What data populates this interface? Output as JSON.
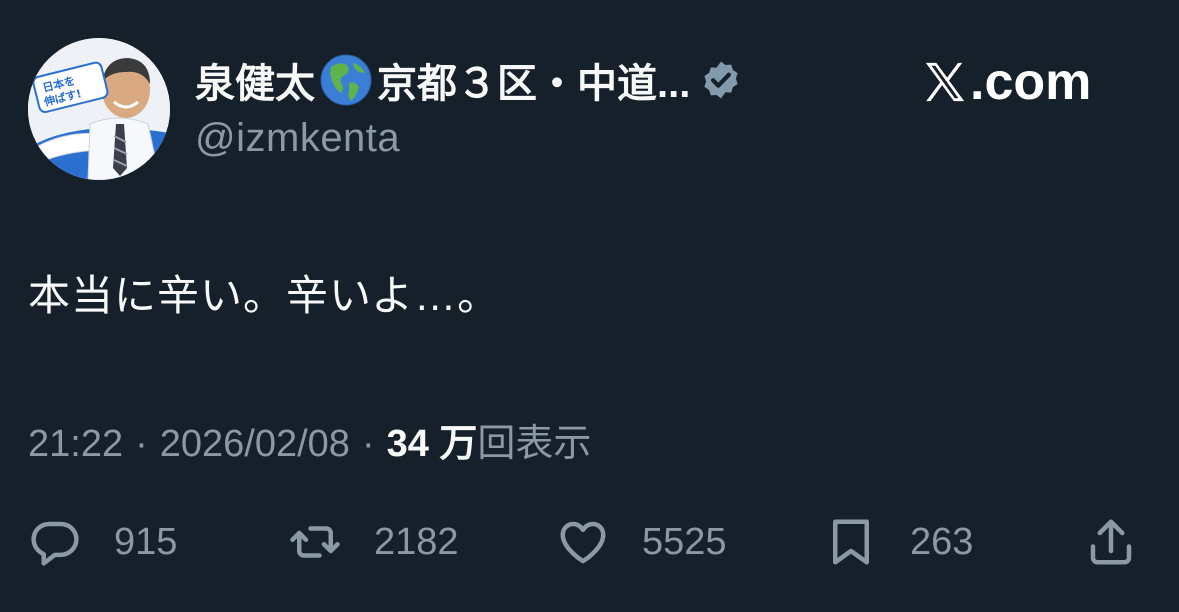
{
  "author": {
    "name_part1": "泉健太",
    "name_part2": "京都３区・中道...",
    "handle": "@izmkenta",
    "avatar_banner_text": "日本を伸ばす!"
  },
  "brand": {
    "label": ".com"
  },
  "tweet": {
    "text": "本当に辛い。辛いよ…。",
    "time": "21:22",
    "date": "2026/02/08",
    "views_count": "34 万",
    "views_label": "回表示",
    "separator": "·"
  },
  "actions": {
    "replies": "915",
    "retweets": "2182",
    "likes": "5525",
    "bookmarks": "263"
  },
  "colors": {
    "background": "#15202b",
    "text": "#f7f9f9",
    "muted": "#8b98a5",
    "verified": "#829aab"
  }
}
